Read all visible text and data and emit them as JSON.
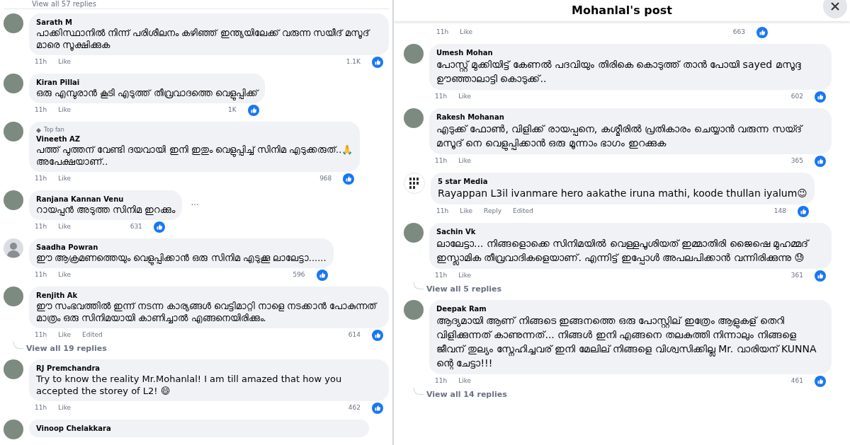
{
  "left_panel": {
    "replies_link": "View all 57 replies",
    "comments": [
      {
        "author": "Sarath M",
        "avatar": {
          "kind": "photo"
        },
        "text": "പാക്കിസ്ഥാനിൽ നിന്ന് പരിശീലനം കഴിഞ്ഞ് ഇന്ത്യയിലേക്ക് വരുന്ന സയീദ് മസൂദ് മാരെ സൂക്ഷിക്കുക",
        "time": "11h",
        "actions": [
          "Like"
        ],
        "reactions": "1.1K"
      },
      {
        "author": "Kiran Pillai",
        "avatar": {
          "kind": "photo"
        },
        "text": "ഒരു എമ്പുരാൻ കൂടി എടുത്ത് തീവ്രവാദത്തെ വെളുപ്പിക്ക്",
        "time": "11h",
        "actions": [
          "Like"
        ],
        "reactions": "1K"
      },
      {
        "author": "Vineeth AZ",
        "badge": "Top fan",
        "avatar": {
          "kind": "photo"
        },
        "text": "പത്ത് പുത്തന് വേണ്ടി ദയവായി ഇനി ഇതും വെളുപ്പിച്ച് സിനിമ എടുക്കരുത്..🙏",
        "text2": "അപേക്ഷയാണ്..",
        "time": "11h",
        "actions": [
          "Like"
        ],
        "reactions": "968"
      },
      {
        "author": "Ranjana Kannan Venu",
        "avatar": {
          "kind": "photo"
        },
        "text": "റായപ്പൻ അടുത്ത സിനിമ ഇറക്കും",
        "more": "···",
        "time": "11h",
        "actions": [
          "Like"
        ],
        "reactions": "631"
      },
      {
        "author": "Saadha Powran",
        "avatar": {
          "kind": "silhouette"
        },
        "text": "ഈ ആക്രമണത്തെയും വെളുപ്പിക്കാൻ ഒരു സിനിമ എടുക്കൂ ലാലേട്ടാ......",
        "time": "11h",
        "actions": [
          "Like"
        ],
        "reactions": "596"
      },
      {
        "author": "Renjith Ak",
        "avatar": {
          "kind": "photo"
        },
        "text": "ഈ സംഭവത്തിൽ ഇന്ന് നടന്ന കാര്യങ്ങൾ വെട്ടിമാറ്റി നാളെ നടക്കാൻ പോകുന്നത് മാത്രം ഒരു സിനിമയായി കാണിച്ചാൽ എങ്ങനെയിരിക്കും.",
        "time": "11h",
        "actions": [
          "Like",
          "Edited"
        ],
        "reactions": "614",
        "replies_link": "View all 19 replies"
      },
      {
        "author": "RJ Premchandra",
        "avatar": {
          "kind": "photo"
        },
        "text": "Try to know the reality Mr.Mohanlal! I am till amazed that how you accepted the storey of L2! 😄",
        "time": "11h",
        "actions": [
          "Like"
        ],
        "reactions": "462"
      },
      {
        "author": "Vinoop Chelakkara",
        "avatar": {
          "kind": "photo"
        }
      }
    ]
  },
  "right_panel": {
    "title": "Mohanlal's post",
    "top_meta": {
      "time": "11h",
      "actions": [
        "Like"
      ],
      "reactions": "663"
    },
    "comments": [
      {
        "author": "Umesh Mohan",
        "avatar": {
          "kind": "photo"
        },
        "text": "പോസ്റ്റ് മുക്കിയിട്ട് കേണൽ പദവിയും തിരികെ കൊടുത്ത് താൻ പോയി sayed മസൂദ്ദ ഊഞ്ഞാലാട്ടി കൊടുക്ക്..",
        "time": "11h",
        "actions": [
          "Like"
        ],
        "reactions": "602"
      },
      {
        "author": "Rakesh Mohanan",
        "avatar": {
          "kind": "photo"
        },
        "text": "എടുക്ക് ഫോൺ, വിളിക്ക് രായപ്പനെ, കശ്മീരിൽ പ്രതികാരം ചെയ്യാൻ വരുന്ന സയ്ദ് മസൂദ് നെ വെളുപ്പിക്കാൻ ഒരു മൂന്നാം ഭാഗം ഇറക്കുക",
        "time": "11h",
        "actions": [
          "Like"
        ],
        "reactions": "365"
      },
      {
        "author": "5 star Media",
        "avatar": {
          "kind": "logo"
        },
        "text": "Rayappan L3il ivanmare hero aakathe iruna mathi, koode thullan iyalum😉",
        "time": "11h",
        "actions": [
          "Like",
          "Reply",
          "Edited"
        ],
        "reactions": "148"
      },
      {
        "author": "Sachin Vk",
        "avatar": {
          "kind": "photo"
        },
        "text": "ലാലേട്ടാ... നിങ്ങളൊക്കെ സിനിമയിൽ വെള്ളപൂശിയത് ഇമ്മാതിരി ജൈഷെ മുഹമ്മദ് ഇസ്ലാമിക തീവ്രവാദികളെയാണ്. എന്നിട്ട് ഇപ്പോൾ അപലപിക്കാൻ വന്നിരിക്കുന്നു 😓",
        "time": "11h",
        "actions": [
          "Like"
        ],
        "reactions": "361",
        "replies_link": "View all 5 replies"
      },
      {
        "author": "Deepak Ram",
        "avatar": {
          "kind": "photo"
        },
        "text": "ആദ്യമായി ആണ് നിങ്ങടെ ഇങ്ങനത്തെ ഒരു പോസ്റ്റില് ഇത്രേം ആളുകള് തെറി വിളിക്കുന്നത് കാണുന്നത്... നിങ്ങൾ ഇനി എങ്ങനെ തലകുത്തി നിന്നാലും നിങ്ങളെ ജീവന് തുല്യം സ്നേഹിച്ചവര് ഇനി മേലില് നിങ്ങളെ വിശ്വസിക്കില്ല Mr. വാരിയന് KUNNA ന്റെ ചേട്ടാ!!!",
        "time": "11h",
        "actions": [
          "Like"
        ],
        "reactions": "461",
        "replies_link": "View all 14 replies"
      }
    ]
  }
}
